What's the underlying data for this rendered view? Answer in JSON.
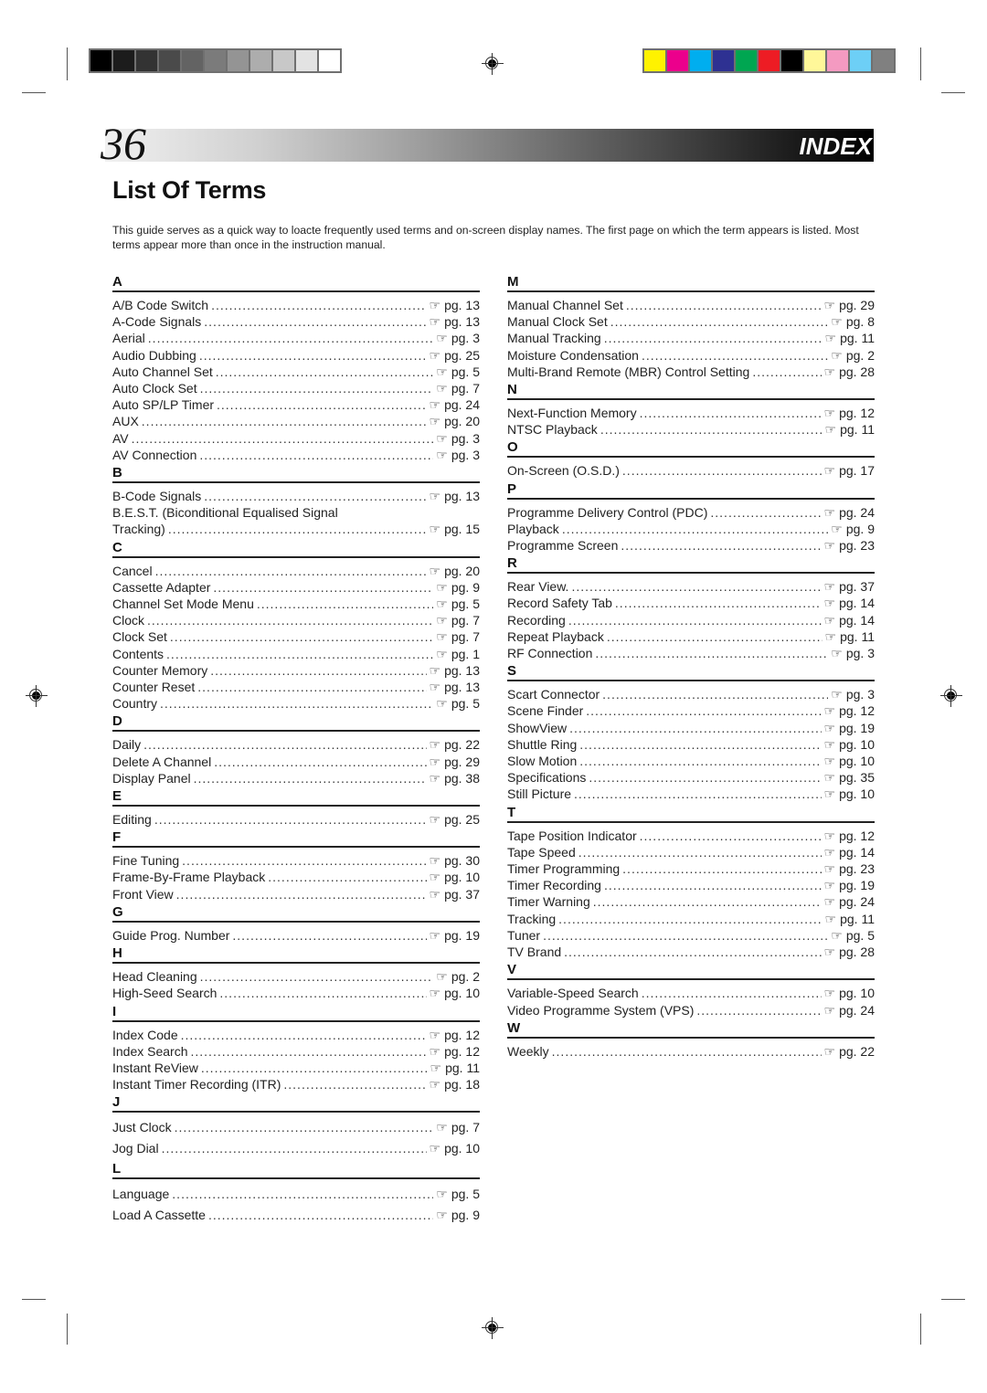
{
  "header": {
    "page_number": "36",
    "section_tag": "INDEX",
    "title": "List Of Terms",
    "intro": "This guide serves as a quick way to loacte frequently used terms and on-screen display names. The first page on which the term appears is listed. Most terms appear more than once in the instruction manual."
  },
  "calibration": {
    "grayscale": [
      "#000000",
      "#1c1c1c",
      "#333333",
      "#4a4a4a",
      "#636363",
      "#7b7b7b",
      "#949494",
      "#adadad",
      "#c8c8c8",
      "#e3e3e3",
      "#ffffff"
    ],
    "colors": [
      "#fff200",
      "#ec008c",
      "#00aeef",
      "#2e3192",
      "#00a651",
      "#ed1c24",
      "#000000",
      "#fff799",
      "#f49ac1",
      "#6dcff6",
      "#808080"
    ]
  },
  "ref_icon": "pointing-hand-icon",
  "ref_glyph": "☞",
  "left_column": [
    {
      "letter": "A",
      "entries": [
        {
          "term": "A/B Code Switch",
          "page": "pg. 13"
        },
        {
          "term": "A-Code Signals",
          "page": "pg. 13"
        },
        {
          "term": "Aerial",
          "page": "pg. 3"
        },
        {
          "term": "Audio Dubbing",
          "page": "pg. 25"
        },
        {
          "term": "Auto Channel Set",
          "page": "pg. 5"
        },
        {
          "term": "Auto Clock Set",
          "page": "pg. 7"
        },
        {
          "term": "Auto SP/LP Timer",
          "page": "pg. 24"
        },
        {
          "term": "AUX",
          "page": "pg. 20"
        },
        {
          "term": "AV",
          "page": "pg. 3"
        },
        {
          "term": "AV Connection",
          "page": "pg. 3"
        }
      ]
    },
    {
      "letter": "B",
      "entries": [
        {
          "term": "B-Code Signals",
          "page": "pg. 13"
        },
        {
          "term": "B.E.S.T. (Biconditional Equalised Signal",
          "page": ""
        },
        {
          "term": "Tracking)",
          "page": "pg. 15"
        }
      ]
    },
    {
      "letter": "C",
      "entries": [
        {
          "term": "Cancel",
          "page": "pg. 20"
        },
        {
          "term": "Cassette Adapter",
          "page": "pg. 9"
        },
        {
          "term": "Channel Set Mode Menu",
          "page": "pg. 5"
        },
        {
          "term": "Clock",
          "page": "pg. 7"
        },
        {
          "term": "Clock Set",
          "page": "pg. 7"
        },
        {
          "term": "Contents",
          "page": "pg. 1"
        },
        {
          "term": "Counter Memory",
          "page": "pg. 13"
        },
        {
          "term": "Counter Reset",
          "page": "pg. 13"
        },
        {
          "term": "Country",
          "page": "pg. 5"
        }
      ]
    },
    {
      "letter": "D",
      "entries": [
        {
          "term": "Daily",
          "page": "pg. 22"
        },
        {
          "term": "Delete A Channel",
          "page": "pg. 29"
        },
        {
          "term": "Display Panel",
          "page": "pg. 38"
        }
      ]
    },
    {
      "letter": "E",
      "entries": [
        {
          "term": "Editing",
          "page": "pg. 25"
        }
      ]
    },
    {
      "letter": "F",
      "entries": [
        {
          "term": "Fine Tuning",
          "page": "pg. 30"
        },
        {
          "term": "Frame-By-Frame Playback",
          "page": "pg. 10"
        },
        {
          "term": "Front View",
          "page": "pg. 37"
        }
      ]
    },
    {
      "letter": "G",
      "entries": [
        {
          "term": "Guide Prog. Number",
          "page": "pg. 19"
        }
      ]
    },
    {
      "letter": "H",
      "entries": [
        {
          "term": "Head Cleaning",
          "page": "pg. 2"
        },
        {
          "term": "High-Seed Search",
          "page": "pg. 10"
        }
      ]
    },
    {
      "letter": "I",
      "entries": [
        {
          "term": "Index Code",
          "page": "pg. 12"
        },
        {
          "term": "Index Search",
          "page": "pg. 12"
        },
        {
          "term": "Instant ReView",
          "page": "pg. 11"
        },
        {
          "term": "Instant Timer Recording (ITR)",
          "page": "pg. 18"
        }
      ]
    },
    {
      "letter": "J",
      "entries": [
        {
          "term": "Just Clock",
          "page": "pg. 7"
        },
        {
          "term": "Jog Dial",
          "page": "pg. 10"
        }
      ]
    },
    {
      "letter": "L",
      "entries": [
        {
          "term": "Language",
          "page": "pg. 5"
        },
        {
          "term": "Load A Cassette",
          "page": "pg. 9"
        }
      ]
    }
  ],
  "right_column": [
    {
      "letter": "M",
      "entries": [
        {
          "term": "Manual Channel Set",
          "page": "pg. 29"
        },
        {
          "term": "Manual Clock Set",
          "page": "pg. 8"
        },
        {
          "term": "Manual Tracking",
          "page": "pg. 11"
        },
        {
          "term": "Moisture Condensation",
          "page": "pg. 2"
        },
        {
          "term": "Multi-Brand Remote (MBR) Control Setting",
          "page": "pg. 28"
        }
      ]
    },
    {
      "letter": "N",
      "entries": [
        {
          "term": "Next-Function Memory",
          "page": "pg. 12"
        },
        {
          "term": "NTSC Playback",
          "page": "pg. 11"
        }
      ]
    },
    {
      "letter": "O",
      "entries": [
        {
          "term": "On-Screen (O.S.D.)",
          "page": "pg. 17"
        }
      ]
    },
    {
      "letter": "P",
      "entries": [
        {
          "term": "Programme Delivery Control (PDC)",
          "page": "pg. 24"
        },
        {
          "term": "Playback",
          "page": "pg. 9"
        },
        {
          "term": "Programme Screen",
          "page": "pg. 23"
        }
      ]
    },
    {
      "letter": "R",
      "entries": [
        {
          "term": "Rear View.",
          "page": "pg. 37"
        },
        {
          "term": "Record Safety Tab",
          "page": "pg. 14"
        },
        {
          "term": "Recording",
          "page": "pg. 14"
        },
        {
          "term": "Repeat Playback",
          "page": "pg. 11"
        },
        {
          "term": "RF Connection",
          "page": "pg. 3"
        }
      ]
    },
    {
      "letter": "S",
      "entries": [
        {
          "term": "Scart Connector",
          "page": "pg. 3"
        },
        {
          "term": "Scene Finder",
          "page": "pg. 12"
        },
        {
          "term": "ShowView",
          "page": "pg. 19"
        },
        {
          "term": "Shuttle Ring",
          "page": "pg. 10"
        },
        {
          "term": "Slow Motion",
          "page": "pg. 10"
        },
        {
          "term": "Specifications",
          "page": "pg. 35"
        },
        {
          "term": "Still Picture",
          "page": "pg. 10"
        }
      ]
    },
    {
      "letter": "T",
      "entries": [
        {
          "term": "Tape Position Indicator",
          "page": "pg. 12"
        },
        {
          "term": "Tape Speed",
          "page": "pg. 14"
        },
        {
          "term": "Timer Programming",
          "page": "pg. 23"
        },
        {
          "term": "Timer Recording",
          "page": "pg. 19"
        },
        {
          "term": "Timer Warning",
          "page": "pg. 24"
        },
        {
          "term": "Tracking",
          "page": "pg. 11"
        },
        {
          "term": "Tuner",
          "page": "pg. 5"
        },
        {
          "term": "TV Brand",
          "page": "pg. 28"
        }
      ]
    },
    {
      "letter": "V",
      "entries": [
        {
          "term": "Variable-Speed Search",
          "page": "pg. 10"
        },
        {
          "term": "Video Programme System (VPS)",
          "page": "pg. 24"
        }
      ]
    },
    {
      "letter": "W",
      "entries": [
        {
          "term": "Weekly",
          "page": "pg. 22"
        }
      ]
    }
  ]
}
